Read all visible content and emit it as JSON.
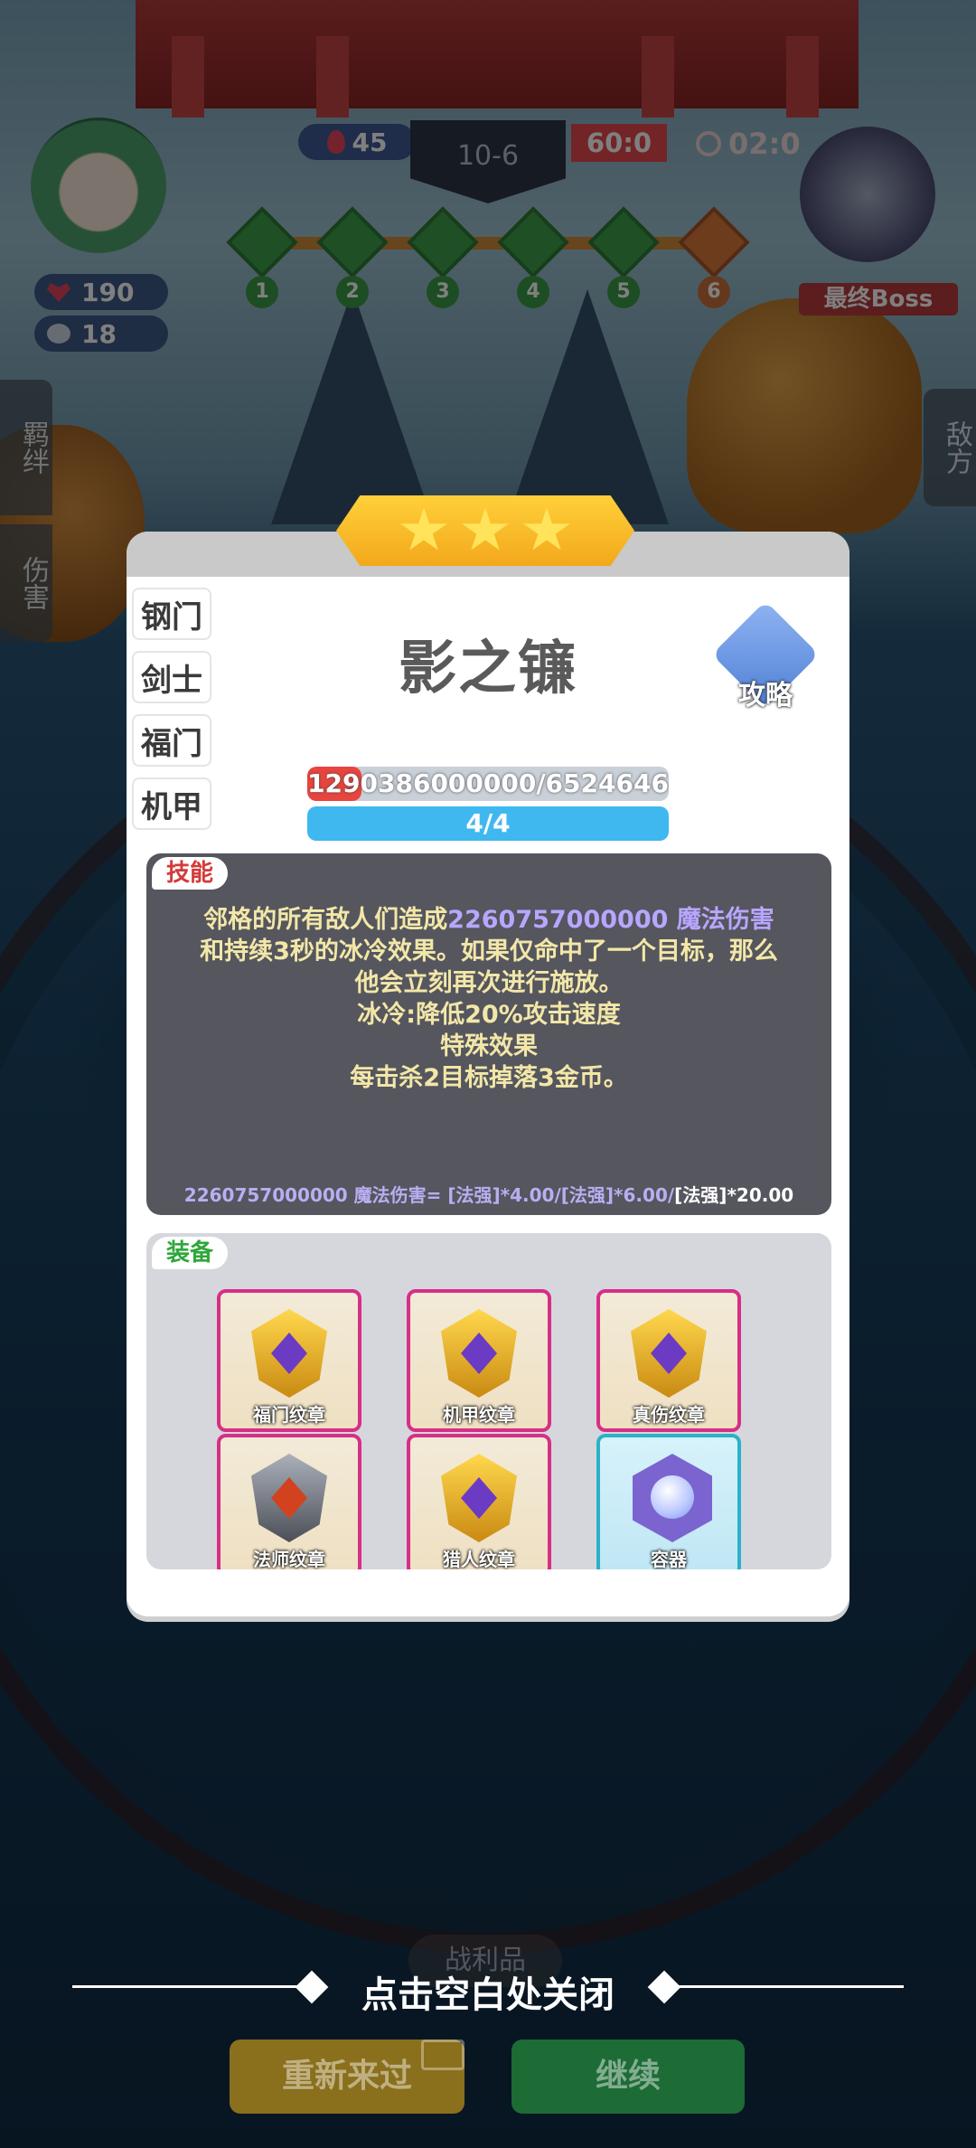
{
  "hud": {
    "health": "190",
    "coins": "18",
    "water": "45",
    "stage": "10-6",
    "score": "60:0",
    "timer": "02:0",
    "boss_label": "最终Boss",
    "rounds": [
      "1",
      "2",
      "3",
      "4",
      "5",
      "6"
    ]
  },
  "side_tabs": {
    "bonds": "羁绊",
    "damage": "伤害",
    "enemy": "敌方"
  },
  "modal": {
    "stars": 3,
    "class_tabs": [
      "钢门",
      "剑士",
      "福门",
      "机甲"
    ],
    "hero_name": "影之镰",
    "guide_label": "攻略",
    "hp_text": "1290386000000/6524646",
    "hp_fraction": 0.15,
    "mana_text": "4/4",
    "skill": {
      "tag": "技能",
      "line1_prefix": "邻格的所有敌人们造成",
      "line1_value": "2260757000000 魔法伤害",
      "line2": "和持续3秒的冰冷效果。如果仅命中了一个目标，那么",
      "line3": "他会立刻再次进行施放。",
      "line4": "冰冷:降低20%攻击速度",
      "line5": "特殊效果",
      "line6": "每击杀2目标掉落3金币。",
      "formula_main": "2260757000000 魔法伤害= [法强]*4.00/[法强]*6.00/",
      "formula_tail": "[法强]*20.00"
    },
    "equipment": {
      "tag": "装备",
      "items": [
        {
          "label": "福门纹章",
          "icon": "gold-emblem-icon"
        },
        {
          "label": "机甲纹章",
          "icon": "gold-emblem-icon"
        },
        {
          "label": "真伤纹章",
          "icon": "gold-emblem-icon"
        },
        {
          "label": "法师纹章",
          "icon": "dark-emblem-icon"
        },
        {
          "label": "猎人纹章",
          "icon": "gold-emblem-icon"
        },
        {
          "label": "容器",
          "icon": "orb-icon"
        }
      ]
    }
  },
  "bottom": {
    "close_hint": "点击空白处关闭",
    "ghost_label": "战利品",
    "restart": "重新来过",
    "continue": "继续"
  },
  "colors": {
    "accent_gold": "#f3a81b",
    "hp_red": "#e8453f",
    "mana_blue": "#3fb8ef",
    "skill_text": "#f2e7a8",
    "skill_value": "#b8a6ff"
  }
}
